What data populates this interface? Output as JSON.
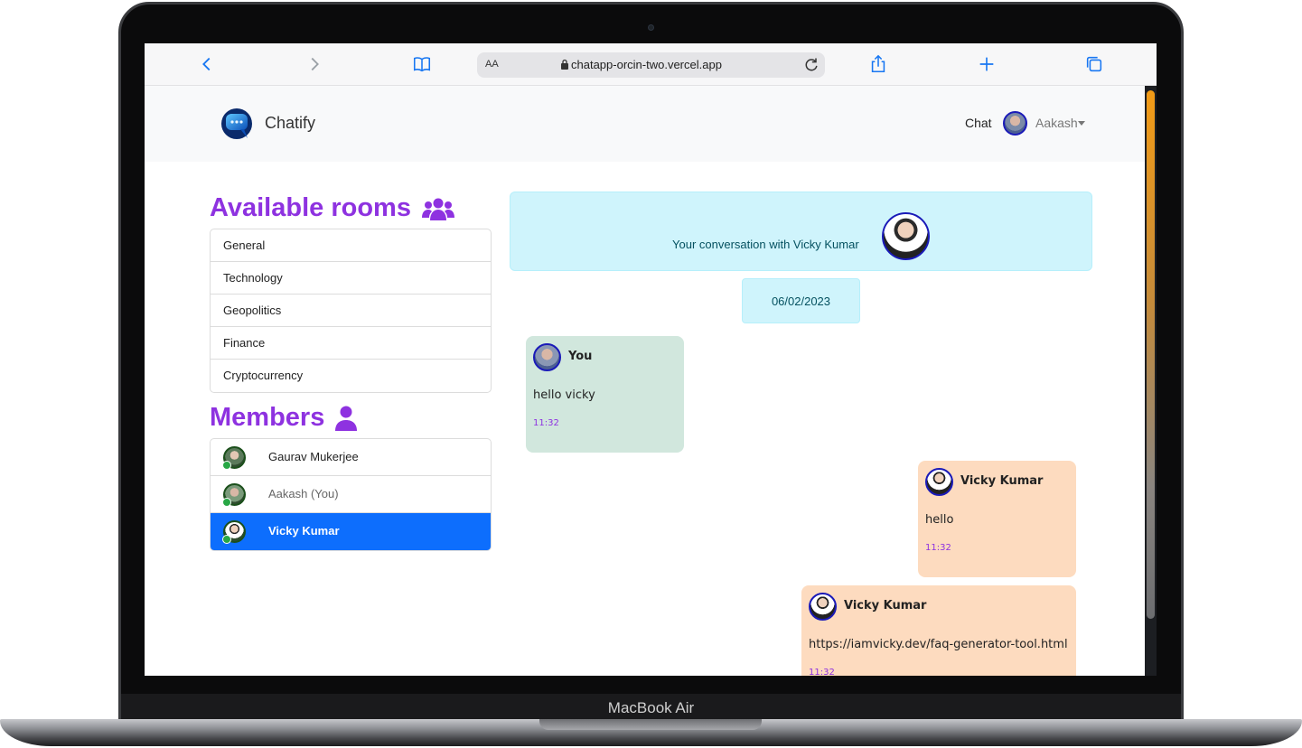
{
  "device": {
    "label": "MacBook Air"
  },
  "browser": {
    "text_size_label": "AA",
    "url": "chatapp-orcin-two.vercel.app"
  },
  "navbar": {
    "brand": "Chatify",
    "chat_link": "Chat",
    "user_name": "Aakash"
  },
  "rooms": {
    "heading": "Available rooms",
    "items": [
      "General",
      "Technology",
      "Geopolitics",
      "Finance",
      "Cryptocurrency"
    ]
  },
  "members": {
    "heading": "Members",
    "items": [
      {
        "name": "Gaurav Mukerjee",
        "status": "online"
      },
      {
        "name": "Aakash (You)",
        "status": "online"
      },
      {
        "name": "Vicky Kumar",
        "status": "online",
        "active": true
      }
    ]
  },
  "chat": {
    "header_text": "Your conversation with Vicky Kumar",
    "date": "06/02/2023",
    "messages": [
      {
        "sender": "You",
        "text": "hello vicky",
        "time": "11:32"
      },
      {
        "sender": "Vicky Kumar",
        "text": "hello",
        "time": "11:32"
      },
      {
        "sender": "Vicky Kumar",
        "text": "https://iamvicky.dev/faq-generator-tool.html",
        "time": "11:32"
      }
    ]
  },
  "colors": {
    "accent_purple": "#8e32e0",
    "active_blue": "#0d6efd",
    "info_bg": "#cff4fc",
    "own_message_bg": "#d1e7dd",
    "other_message_bg": "#fddbbf",
    "browser_blue": "#1877f2"
  }
}
